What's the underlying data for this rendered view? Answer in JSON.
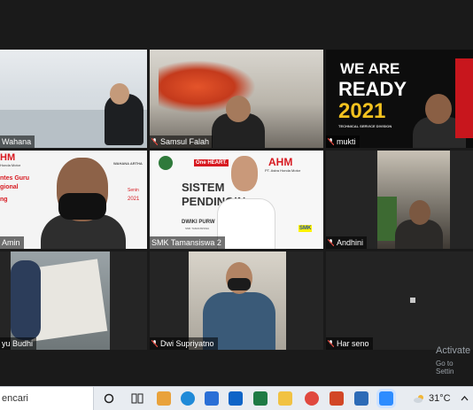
{
  "participants": [
    {
      "name": "Wahana",
      "muted": false
    },
    {
      "name": "Samsul Falah",
      "muted": true
    },
    {
      "name": "mukti",
      "muted": true
    },
    {
      "name": "Amin",
      "muted": false
    },
    {
      "name": "SMK Tamansiswa 2",
      "muted": false
    },
    {
      "name": "Andhini",
      "muted": true
    },
    {
      "name": "yu Budhi",
      "muted": false
    },
    {
      "name": "Dwi Supriyatno",
      "muted": true
    },
    {
      "name": "Har seno",
      "muted": true
    }
  ],
  "tile_texts": {
    "we_are": "WE ARE",
    "ready": "READY",
    "year": "2021",
    "tsd": "TECHNICAL SERVICE DIVISION",
    "honda_motor": "Honda Motor",
    "ahm_left": "HM",
    "ntes_guru": "ntes Guru",
    "gional": "gional",
    "ng": "ng",
    "senin": "Senin",
    "yr2021": "2021",
    "wahana_artha": "WAHANA ARTHA",
    "sistem": "SISTEM",
    "pendingin": "PENDINGIN",
    "dwiki": "DWIKI PURW",
    "smk_small": "SMK TAMANSISWA",
    "one_heart": "One HEART.",
    "ahm": "AHM",
    "astra_honda": "PT. Astra Honda Motor",
    "smk_logo": "SMK"
  },
  "watermark": {
    "line1": "Activate",
    "line2": "Go to Settin"
  },
  "taskbar": {
    "search_text": "encari",
    "temperature": "31°C"
  },
  "colors": {
    "active_speaker": "#c8e24a",
    "mute_red": "#e0483e",
    "background": "#1a1a1a"
  }
}
